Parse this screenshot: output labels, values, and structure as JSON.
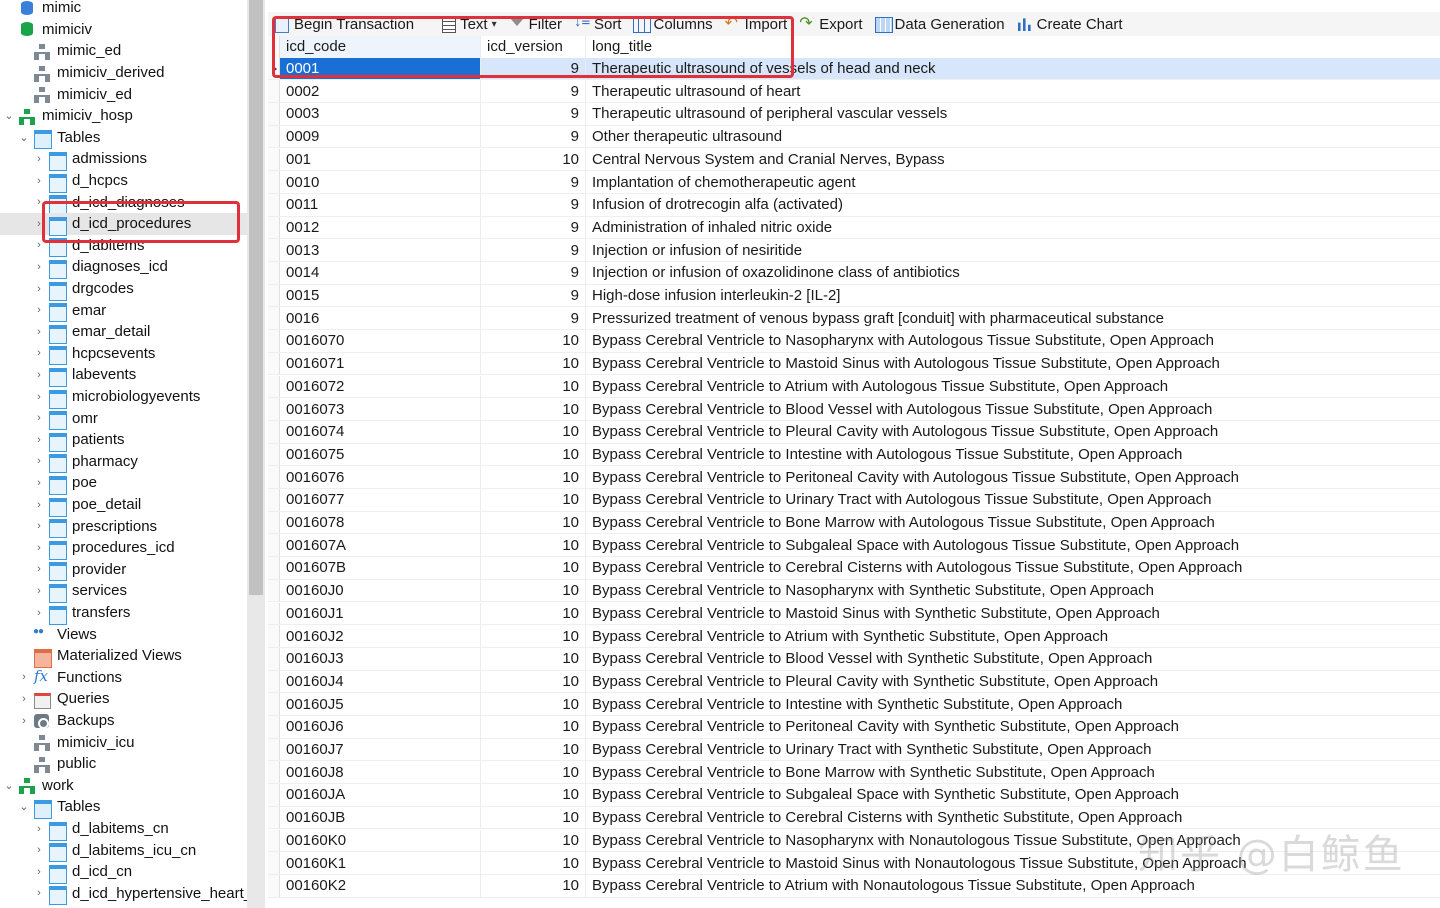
{
  "sidebar": {
    "items": [
      {
        "label": "mimic",
        "icon": "database-icon",
        "chev": "",
        "indent": 0
      },
      {
        "label": "mimiciv",
        "icon": "database-icon",
        "chev": "",
        "indent": 0
      },
      {
        "label": "mimic_ed",
        "icon": "schema-icon",
        "chev": "",
        "indent": 1
      },
      {
        "label": "mimiciv_derived",
        "icon": "schema-icon",
        "chev": "",
        "indent": 1
      },
      {
        "label": "mimiciv_ed",
        "icon": "schema-icon",
        "chev": "",
        "indent": 1
      },
      {
        "label": "mimiciv_hosp",
        "icon": "schema-open-icon",
        "chev": "down",
        "indent": 0
      },
      {
        "label": "Tables",
        "icon": "tables-folder-icon",
        "chev": "down",
        "indent": 1
      },
      {
        "label": "admissions",
        "icon": "table-icon",
        "chev": "right",
        "indent": 2
      },
      {
        "label": "d_hcpcs",
        "icon": "table-icon",
        "chev": "right",
        "indent": 2
      },
      {
        "label": "d_icd_diagnoses",
        "icon": "table-icon",
        "chev": "right",
        "indent": 2
      },
      {
        "label": "d_icd_procedures",
        "icon": "table-icon",
        "chev": "right",
        "indent": 2,
        "selected": true
      },
      {
        "label": "d_labitems",
        "icon": "table-icon",
        "chev": "right",
        "indent": 2
      },
      {
        "label": "diagnoses_icd",
        "icon": "table-icon",
        "chev": "right",
        "indent": 2
      },
      {
        "label": "drgcodes",
        "icon": "table-icon",
        "chev": "right",
        "indent": 2
      },
      {
        "label": "emar",
        "icon": "table-icon",
        "chev": "right",
        "indent": 2
      },
      {
        "label": "emar_detail",
        "icon": "table-icon",
        "chev": "right",
        "indent": 2
      },
      {
        "label": "hcpcsevents",
        "icon": "table-icon",
        "chev": "right",
        "indent": 2
      },
      {
        "label": "labevents",
        "icon": "table-icon",
        "chev": "right",
        "indent": 2
      },
      {
        "label": "microbiologyevents",
        "icon": "table-icon",
        "chev": "right",
        "indent": 2
      },
      {
        "label": "omr",
        "icon": "table-icon",
        "chev": "right",
        "indent": 2
      },
      {
        "label": "patients",
        "icon": "table-icon",
        "chev": "right",
        "indent": 2
      },
      {
        "label": "pharmacy",
        "icon": "table-icon",
        "chev": "right",
        "indent": 2
      },
      {
        "label": "poe",
        "icon": "table-icon",
        "chev": "right",
        "indent": 2
      },
      {
        "label": "poe_detail",
        "icon": "table-icon",
        "chev": "right",
        "indent": 2
      },
      {
        "label": "prescriptions",
        "icon": "table-icon",
        "chev": "right",
        "indent": 2
      },
      {
        "label": "procedures_icd",
        "icon": "table-icon",
        "chev": "right",
        "indent": 2
      },
      {
        "label": "provider",
        "icon": "table-icon",
        "chev": "right",
        "indent": 2
      },
      {
        "label": "services",
        "icon": "table-icon",
        "chev": "right",
        "indent": 2
      },
      {
        "label": "transfers",
        "icon": "table-icon",
        "chev": "right",
        "indent": 2
      },
      {
        "label": "Views",
        "icon": "views-icon",
        "chev": "",
        "indent": 1
      },
      {
        "label": "Materialized Views",
        "icon": "materialized-views-icon",
        "chev": "",
        "indent": 1
      },
      {
        "label": "Functions",
        "icon": "functions-icon",
        "chev": "right",
        "indent": 1
      },
      {
        "label": "Queries",
        "icon": "queries-icon",
        "chev": "right",
        "indent": 1
      },
      {
        "label": "Backups",
        "icon": "backups-icon",
        "chev": "right",
        "indent": 1
      },
      {
        "label": "mimiciv_icu",
        "icon": "schema-icon",
        "chev": "",
        "indent": 1
      },
      {
        "label": "public",
        "icon": "schema-icon",
        "chev": "",
        "indent": 1
      },
      {
        "label": "work",
        "icon": "schema-open-icon",
        "chev": "down",
        "indent": 0
      },
      {
        "label": "Tables",
        "icon": "tables-folder-icon",
        "chev": "down",
        "indent": 1
      },
      {
        "label": "d_labitems_cn",
        "icon": "table-icon",
        "chev": "right",
        "indent": 2
      },
      {
        "label": "d_labitems_icu_cn",
        "icon": "table-icon",
        "chev": "right",
        "indent": 2
      },
      {
        "label": "d_icd_cn",
        "icon": "table-icon",
        "chev": "right",
        "indent": 2
      },
      {
        "label": "d_icd_hypertensive_heart_",
        "icon": "table-icon",
        "chev": "right",
        "indent": 2
      }
    ]
  },
  "toolbar": {
    "buttons": [
      {
        "label": "Begin Transaction",
        "icon": "begin-transaction-icon"
      },
      {
        "label": "Text",
        "icon": "text-icon",
        "dropdown": true
      },
      {
        "label": "Filter",
        "icon": "filter-icon"
      },
      {
        "label": "Sort",
        "icon": "sort-icon"
      },
      {
        "label": "Columns",
        "icon": "columns-icon"
      },
      {
        "label": "Import",
        "icon": "import-icon"
      },
      {
        "label": "Export",
        "icon": "export-icon"
      },
      {
        "label": "Data Generation",
        "icon": "data-generation-icon"
      },
      {
        "label": "Create Chart",
        "icon": "create-chart-icon"
      }
    ]
  },
  "grid": {
    "columns": [
      "icd_code",
      "icd_version",
      "long_title"
    ],
    "rows": [
      [
        "0001",
        "9",
        "Therapeutic ultrasound of vessels of head and neck"
      ],
      [
        "0002",
        "9",
        "Therapeutic ultrasound of heart"
      ],
      [
        "0003",
        "9",
        "Therapeutic ultrasound of peripheral vascular vessels"
      ],
      [
        "0009",
        "9",
        "Other therapeutic ultrasound"
      ],
      [
        "001",
        "10",
        "Central Nervous System and Cranial Nerves, Bypass"
      ],
      [
        "0010",
        "9",
        "Implantation of chemotherapeutic agent"
      ],
      [
        "0011",
        "9",
        "Infusion of drotrecogin alfa (activated)"
      ],
      [
        "0012",
        "9",
        "Administration of inhaled nitric oxide"
      ],
      [
        "0013",
        "9",
        "Injection or infusion of nesiritide"
      ],
      [
        "0014",
        "9",
        "Injection or infusion of oxazolidinone class of antibiotics"
      ],
      [
        "0015",
        "9",
        "High-dose infusion interleukin-2 [IL-2]"
      ],
      [
        "0016",
        "9",
        "Pressurized treatment of venous bypass graft [conduit] with pharmaceutical substance"
      ],
      [
        "0016070",
        "10",
        "Bypass Cerebral Ventricle to Nasopharynx with Autologous Tissue Substitute, Open Approach"
      ],
      [
        "0016071",
        "10",
        "Bypass Cerebral Ventricle to Mastoid Sinus with Autologous Tissue Substitute, Open Approach"
      ],
      [
        "0016072",
        "10",
        "Bypass Cerebral Ventricle to Atrium with Autologous Tissue Substitute, Open Approach"
      ],
      [
        "0016073",
        "10",
        "Bypass Cerebral Ventricle to Blood Vessel with Autologous Tissue Substitute, Open Approach"
      ],
      [
        "0016074",
        "10",
        "Bypass Cerebral Ventricle to Pleural Cavity with Autologous Tissue Substitute, Open Approach"
      ],
      [
        "0016075",
        "10",
        "Bypass Cerebral Ventricle to Intestine with Autologous Tissue Substitute, Open Approach"
      ],
      [
        "0016076",
        "10",
        "Bypass Cerebral Ventricle to Peritoneal Cavity with Autologous Tissue Substitute, Open Approach"
      ],
      [
        "0016077",
        "10",
        "Bypass Cerebral Ventricle to Urinary Tract with Autologous Tissue Substitute, Open Approach"
      ],
      [
        "0016078",
        "10",
        "Bypass Cerebral Ventricle to Bone Marrow with Autologous Tissue Substitute, Open Approach"
      ],
      [
        "001607A",
        "10",
        "Bypass Cerebral Ventricle to Subgaleal Space with Autologous Tissue Substitute, Open Approach"
      ],
      [
        "001607B",
        "10",
        "Bypass Cerebral Ventricle to Cerebral Cisterns with Autologous Tissue Substitute, Open Approach"
      ],
      [
        "00160J0",
        "10",
        "Bypass Cerebral Ventricle to Nasopharynx with Synthetic Substitute, Open Approach"
      ],
      [
        "00160J1",
        "10",
        "Bypass Cerebral Ventricle to Mastoid Sinus with Synthetic Substitute, Open Approach"
      ],
      [
        "00160J2",
        "10",
        "Bypass Cerebral Ventricle to Atrium with Synthetic Substitute, Open Approach"
      ],
      [
        "00160J3",
        "10",
        "Bypass Cerebral Ventricle to Blood Vessel with Synthetic Substitute, Open Approach"
      ],
      [
        "00160J4",
        "10",
        "Bypass Cerebral Ventricle to Pleural Cavity with Synthetic Substitute, Open Approach"
      ],
      [
        "00160J5",
        "10",
        "Bypass Cerebral Ventricle to Intestine with Synthetic Substitute, Open Approach"
      ],
      [
        "00160J6",
        "10",
        "Bypass Cerebral Ventricle to Peritoneal Cavity with Synthetic Substitute, Open Approach"
      ],
      [
        "00160J7",
        "10",
        "Bypass Cerebral Ventricle to Urinary Tract with Synthetic Substitute, Open Approach"
      ],
      [
        "00160J8",
        "10",
        "Bypass Cerebral Ventricle to Bone Marrow with Synthetic Substitute, Open Approach"
      ],
      [
        "00160JA",
        "10",
        "Bypass Cerebral Ventricle to Subgaleal Space with Synthetic Substitute, Open Approach"
      ],
      [
        "00160JB",
        "10",
        "Bypass Cerebral Ventricle to Cerebral Cisterns with Synthetic Substitute, Open Approach"
      ],
      [
        "00160K0",
        "10",
        "Bypass Cerebral Ventricle to Nasopharynx with Nonautologous Tissue Substitute, Open Approach"
      ],
      [
        "00160K1",
        "10",
        "Bypass Cerebral Ventricle to Mastoid Sinus with Nonautologous Tissue Substitute, Open Approach"
      ],
      [
        "00160K2",
        "10",
        "Bypass Cerebral Ventricle to Atrium with Nonautologous Tissue Substitute, Open Approach"
      ]
    ],
    "selected_row": 0
  },
  "watermark": "知乎 @白鲸鱼",
  "colors": {
    "annotation": "#e0313b",
    "selection": "#1a6fd6",
    "selected_row": "#d7e6fb"
  }
}
